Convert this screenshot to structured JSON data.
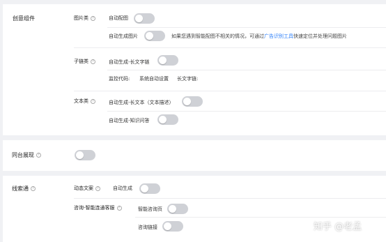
{
  "creative": {
    "title": "创意组件",
    "image_group": {
      "label": "图片类",
      "auto_match": "自动配图",
      "auto_generate": "自动生成图片",
      "hint_before": "如果您遇到智能配图不相关的情况，可通过",
      "hint_link": "广告识别工具",
      "hint_after": "快速定位并处理问题图片"
    },
    "sublink_group": {
      "label": "子链类",
      "auto_long": "自动生成-长文字链",
      "monitor_label": "监控代码:",
      "monitor_value": "系统自动设置",
      "long_text_label": "长文字链:"
    },
    "text_group": {
      "label": "文本类",
      "auto_long_text": "自动生成-长文本（文本描述）",
      "auto_qa": "自动生成-知识问答"
    }
  },
  "sync": {
    "title": "同台展现"
  },
  "leads": {
    "title": "线索通",
    "dynamic_copy": {
      "label": "动态文案",
      "auto": "自动生成"
    },
    "consult": {
      "label": "咨询-智能连通客服",
      "smart_page": "智能咨询页",
      "consult_link": "咨询链接"
    }
  },
  "watermark": "知乎 @老孟",
  "help_glyph": "?"
}
